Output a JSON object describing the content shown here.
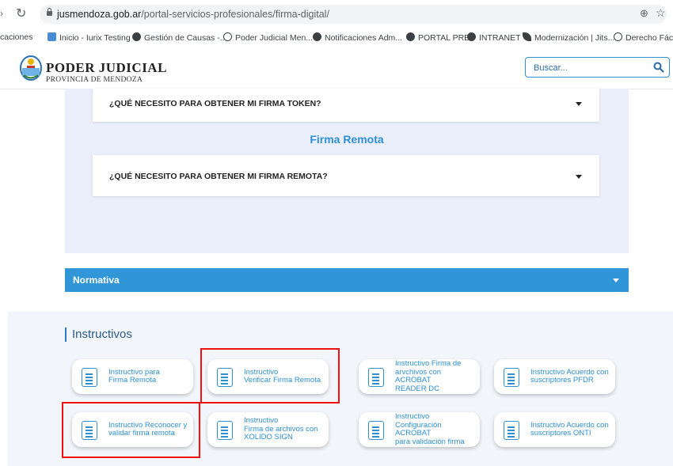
{
  "browser": {
    "url_host": "jusmendoza.gob.ar",
    "url_path": "/portal-servicios-profesionales/firma-digital/",
    "bookmarks": [
      "caciones",
      "Inicio - Iurix Testing",
      "Gestión de Causas -...",
      "Poder Judicial Men...",
      "Notificaciones Adm...",
      "PORTAL PRE",
      "INTRANET",
      "Modernización | Jits...",
      "Derecho Fácil |"
    ]
  },
  "header": {
    "brand_title": "PODER JUDICIAL",
    "brand_subtitle": "PROVINCIA DE MENDOZA",
    "search_placeholder": "Buscar..."
  },
  "accordion": {
    "item1": "¿QUÉ NECESITO PARA OBTENER MI FIRMA TOKEN?",
    "section_title": "Firma Remota",
    "item2": "¿QUÉ NECESITO PARA OBTENER MI FIRMA REMOTA?"
  },
  "normativa": {
    "label": "Normativa"
  },
  "instructivos": {
    "title": "Instructivos",
    "cards": [
      [
        "Instructivo para",
        "Firma Remota"
      ],
      [
        "Instructivo",
        "Verificar Firma Remota"
      ],
      [
        "Instructivo Firma de",
        "arvchivos con ACROBAT",
        "READER DC"
      ],
      [
        "Instructivo Acuerdo con",
        "suscriptores PFDR"
      ],
      [
        "Instructivo Reconocer y",
        "validar firma remota"
      ],
      [
        "Instructivo",
        "Firma de archivos con",
        "XOLIDO SIGN"
      ],
      [
        "Instructivo",
        "Configuración ACROBAT",
        "para validación firma"
      ],
      [
        "Instructivo Acuerdo con",
        "suscriptores ONTI"
      ]
    ]
  },
  "colors": {
    "accent_blue": "#3096d8",
    "panel_bg": "#ebeffb",
    "highlight_red": "#e11111"
  }
}
